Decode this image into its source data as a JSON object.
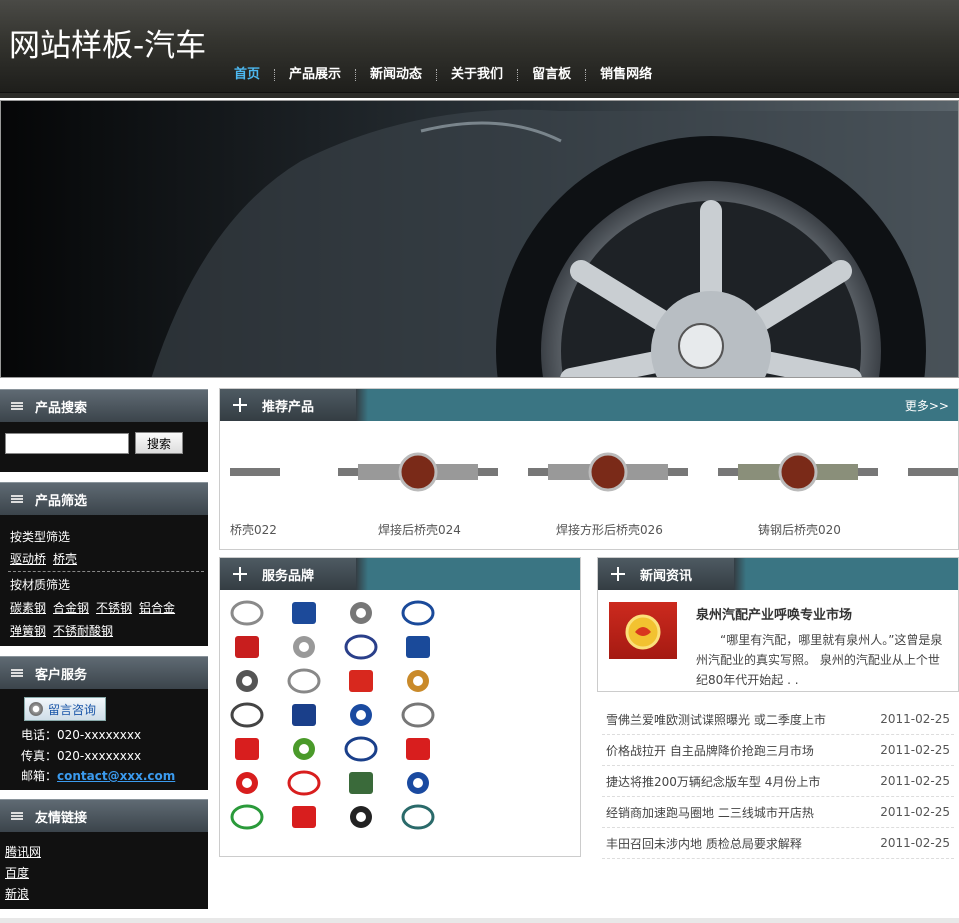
{
  "header": {
    "title": "网站样板-汽车",
    "nav": [
      {
        "label": "首页",
        "active": true
      },
      {
        "label": "产品展示",
        "active": false
      },
      {
        "label": "新闻动态",
        "active": false
      },
      {
        "label": "关于我们",
        "active": false
      },
      {
        "label": "留言板",
        "active": false
      },
      {
        "label": "销售网络",
        "active": false
      }
    ]
  },
  "sidebar": {
    "search": {
      "title": "产品搜索",
      "button": "搜索",
      "value": ""
    },
    "filter": {
      "title": "产品筛选",
      "by_type": "按类型筛选",
      "type_links": [
        "驱动桥",
        "桥壳"
      ],
      "by_material": "按材质筛选",
      "material_links_row1": [
        "碳素钢",
        "合金钢",
        "不锈钢",
        "铝合金"
      ],
      "material_links_row2": [
        "弹簧钢",
        "不锈耐酸钢"
      ]
    },
    "service": {
      "title": "客户服务",
      "message_button": "留言咨询",
      "phone": "电话：020-xxxxxxxx",
      "fax": "传真：020-xxxxxxxx",
      "email_label": "邮箱：",
      "email": "contact@xxx.com"
    },
    "links": {
      "title": "友情链接",
      "items": [
        "腾讯网",
        "百度",
        "新浪"
      ]
    }
  },
  "products": {
    "title": "推荐产品",
    "more": "更多>>",
    "items": [
      "桥壳022",
      "焊接后桥壳024",
      "焊接方形后桥壳026",
      "铸钢后桥壳020"
    ]
  },
  "brands": {
    "title": "服务品牌",
    "logos": [
      "toyota-logo",
      "volkswagen-logo",
      "renault-logo",
      "gm-logo",
      "nissan-logo",
      "audi-logo",
      "peugeot-logo",
      "ford-logo",
      "honda-logo",
      "mercedes-logo",
      "citroen-logo",
      "chrysler-logo",
      "mazda-logo",
      "bmw-logo",
      "volvo-logo",
      "opel-logo",
      "mitsubishi-logo",
      "opel-green-logo",
      "saab-logo",
      "kia-logo",
      "logo-red-square",
      "daihatsu-logo",
      "land-rover-logo",
      "hyundai-logo",
      "suzuki-logo",
      "hino-logo",
      "subaru-logo",
      "daewoo-logo"
    ]
  },
  "news": {
    "title": "新闻资讯",
    "headline": "泉州汽配产业呼唤专业市场",
    "summary": "“哪里有汽配，哪里就有泉州人。”这曾是泉州汽配业的真实写照。 泉州的汽配业从上个世纪80年代开始起 . .",
    "list": [
      {
        "title": "雪佛兰爱唯欧测试谍照曝光 或二季度上市",
        "date": "2011-02-25"
      },
      {
        "title": "价格战拉开 自主品牌降价抢跑三月市场",
        "date": "2011-02-25"
      },
      {
        "title": "捷达将推200万辆纪念版车型 4月份上市",
        "date": "2011-02-25"
      },
      {
        "title": "经销商加速跑马圈地 二三线城市开店热",
        "date": "2011-02-25"
      },
      {
        "title": "丰田召回未涉内地 质检总局要求解释",
        "date": "2011-02-25"
      }
    ]
  },
  "colors": {
    "accent": "#3a7583",
    "nav_active": "#4db8f0",
    "email": "#3b9bef"
  }
}
